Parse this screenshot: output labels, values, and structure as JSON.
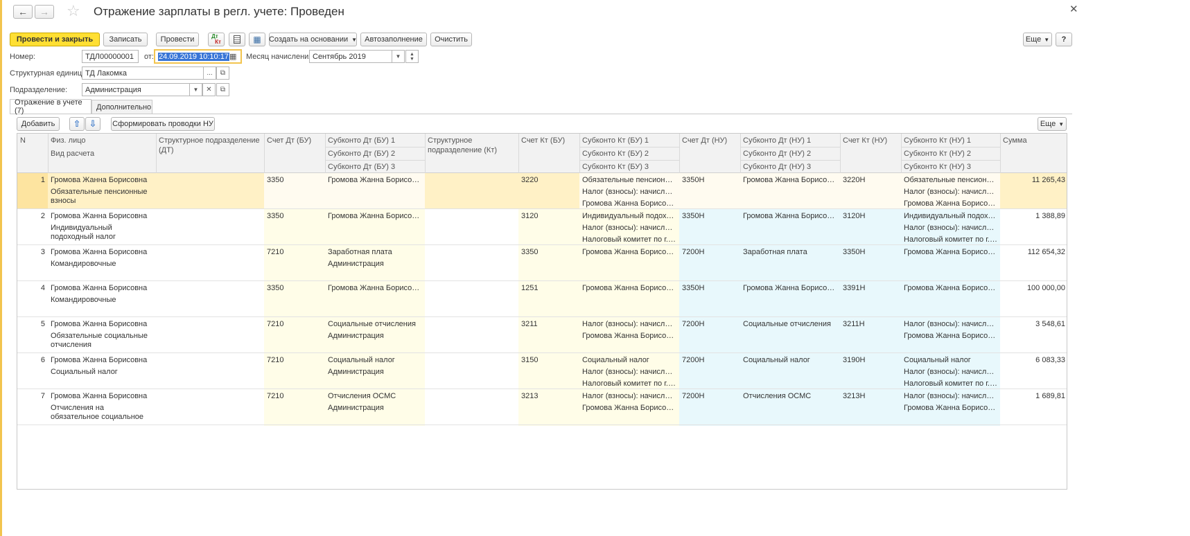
{
  "window": {
    "title": "Отражение зарплаты в регл. учете: Проведен"
  },
  "toolbar": {
    "post_close": "Провести и закрыть",
    "save": "Записать",
    "post": "Провести",
    "dtkt_icon_top": "Дт",
    "dtkt_icon_bottom": "Кт",
    "create_based": "Создать на основании",
    "autofill": "Автозаполнение",
    "clear": "Очистить",
    "more": "Еще",
    "help": "?"
  },
  "form": {
    "number_label": "Номер:",
    "number_value": "ТДЛ00000001",
    "from_label": "от:",
    "date_value": "24.09.2019 10:10:17",
    "month_label": "Месяц начисления:",
    "month_value": "Сентябрь 2019",
    "unit_label": "Структурная единица:",
    "unit_value": "ТД Лакомка",
    "dept_label": "Подразделение:",
    "dept_value": "Администрация"
  },
  "tabs": [
    {
      "label": "Отражение в учете (7)"
    },
    {
      "label": "Дополнительно"
    }
  ],
  "table_toolbar": {
    "add": "Добавить",
    "generate": "Сформировать проводки НУ",
    "more": "Еще"
  },
  "columns": {
    "n": "N",
    "person": "Физ. лицо",
    "calc_type": "Вид расчета",
    "dept_dt": "Структурное подразделение (ДТ)",
    "acc_dt_bu": "Счет Дт (БУ)",
    "sub_dt_bu_1": "Субконто Дт  (БУ) 1",
    "sub_dt_bu_2": "Субконто Дт  (БУ) 2",
    "sub_dt_bu_3": "Субконто Дт  (БУ) 3",
    "dept_kt": "Структурное подразделение (Кт)",
    "acc_kt_bu": "Счет Кт  (БУ)",
    "sub_kt_bu_1": "Субконто Кт  (БУ) 1",
    "sub_kt_bu_2": "Субконто Кт  (БУ) 2",
    "sub_kt_bu_3": "Субконто Кт  (БУ) 3",
    "acc_dt_nu": "Счет Дт (НУ)",
    "sub_dt_nu_1": "Субконто Дт (НУ) 1",
    "sub_dt_nu_2": "Субконто Дт (НУ) 2",
    "sub_dt_nu_3": "Субконто Дт (НУ) 3",
    "acc_kt_nu": "Счет Кт (НУ)",
    "sub_kt_nu_1": "Субконто Кт (НУ) 1",
    "sub_kt_nu_2": "Субконто Кт (НУ) 2",
    "sub_kt_nu_3": "Субконто Кт (НУ) 3",
    "sum": "Сумма"
  },
  "rows": [
    {
      "n": "1",
      "person": "Громова Жанна Борисовна",
      "calc": "Обязательные пенсионные взносы",
      "acc_dt_bu": "3350",
      "sub_dt_bu": [
        "Громова Жанна Борисовна",
        "",
        ""
      ],
      "acc_kt_bu": "3220",
      "sub_kt_bu": [
        "Обязательные пенсионны...",
        "Налог (взносы): начислено...",
        "Громова Жанна Борисовна"
      ],
      "acc_dt_nu": "3350Н",
      "sub_dt_nu": [
        "Громова Жанна Борисовна",
        "",
        ""
      ],
      "acc_kt_nu": "3220Н",
      "sub_kt_nu": [
        "Обязательные пенсионны...",
        "Налог (взносы): начислено...",
        "Громова Жанна Борисовна"
      ],
      "sum": "11 265,43"
    },
    {
      "n": "2",
      "person": "Громова Жанна Борисовна",
      "calc": "Индивидуальный подоходный налог",
      "acc_dt_bu": "3350",
      "sub_dt_bu": [
        "Громова Жанна Борисовна",
        "",
        ""
      ],
      "acc_kt_bu": "3120",
      "sub_kt_bu": [
        "Индивидуальный подоходн...",
        "Налог (взносы): начислено...",
        "Налоговый комитет по г.А..."
      ],
      "acc_dt_nu": "3350Н",
      "sub_dt_nu": [
        "Громова Жанна Борисовна",
        "",
        ""
      ],
      "acc_kt_nu": "3120Н",
      "sub_kt_nu": [
        "Индивидуальный подоходн...",
        "Налог (взносы): начислено...",
        "Налоговый комитет по г.А..."
      ],
      "sum": "1 388,89"
    },
    {
      "n": "3",
      "person": "Громова Жанна Борисовна",
      "calc": "Командировочные",
      "acc_dt_bu": "7210",
      "sub_dt_bu": [
        "Заработная плата",
        "Администрация",
        ""
      ],
      "acc_kt_bu": "3350",
      "sub_kt_bu": [
        "Громова Жанна Борисовна",
        "",
        ""
      ],
      "acc_dt_nu": "7200Н",
      "sub_dt_nu": [
        "Заработная плата",
        "",
        ""
      ],
      "acc_kt_nu": "3350Н",
      "sub_kt_nu": [
        "Громова Жанна Борисовна",
        "",
        ""
      ],
      "sum": "112 654,32"
    },
    {
      "n": "4",
      "person": "Громова Жанна Борисовна",
      "calc": "Командировочные",
      "acc_dt_bu": "3350",
      "sub_dt_bu": [
        "Громова Жанна Борисовна",
        "",
        ""
      ],
      "acc_kt_bu": "1251",
      "sub_kt_bu": [
        "Громова Жанна Борисовна",
        "",
        ""
      ],
      "acc_dt_nu": "3350Н",
      "sub_dt_nu": [
        "Громова Жанна Борисовна",
        "",
        ""
      ],
      "acc_kt_nu": "3391Н",
      "sub_kt_nu": [
        "Громова Жанна Борисовна",
        "",
        ""
      ],
      "sum": "100 000,00"
    },
    {
      "n": "5",
      "person": "Громова Жанна Борисовна",
      "calc": "Обязательные социальные отчисления",
      "acc_dt_bu": "7210",
      "sub_dt_bu": [
        "Социальные отчисления",
        "Администрация",
        ""
      ],
      "acc_kt_bu": "3211",
      "sub_kt_bu": [
        "Налог (взносы): начислено...",
        "Громова Жанна Борисовна",
        ""
      ],
      "acc_dt_nu": "7200Н",
      "sub_dt_nu": [
        "Социальные отчисления",
        "",
        ""
      ],
      "acc_kt_nu": "3211Н",
      "sub_kt_nu": [
        "Налог (взносы): начислено...",
        "Громова Жанна Борисовна",
        ""
      ],
      "sum": "3 548,61"
    },
    {
      "n": "6",
      "person": "Громова Жанна Борисовна",
      "calc": "Социальный налог",
      "acc_dt_bu": "7210",
      "sub_dt_bu": [
        "Социальный налог",
        "Администрация",
        ""
      ],
      "acc_kt_bu": "3150",
      "sub_kt_bu": [
        "Социальный налог",
        "Налог (взносы): начислено...",
        "Налоговый комитет по г.А..."
      ],
      "acc_dt_nu": "7200Н",
      "sub_dt_nu": [
        "Социальный налог",
        "",
        ""
      ],
      "acc_kt_nu": "3190Н",
      "sub_kt_nu": [
        "Социальный налог",
        "Налог (взносы): начислено...",
        "Налоговый комитет по г.А..."
      ],
      "sum": "6 083,33"
    },
    {
      "n": "7",
      "person": "Громова Жанна Борисовна",
      "calc": "Отчисления на обязательное социальное медицинское ...",
      "acc_dt_bu": "7210",
      "sub_dt_bu": [
        "Отчисления ОСМС",
        "Администрация",
        ""
      ],
      "acc_kt_bu": "3213",
      "sub_kt_bu": [
        "Налог (взносы): начислено...",
        "Громова Жанна Борисовна",
        ""
      ],
      "acc_dt_nu": "7200Н",
      "sub_dt_nu": [
        "Отчисления ОСМС",
        "",
        ""
      ],
      "acc_kt_nu": "3213Н",
      "sub_kt_nu": [
        "Налог (взносы): начислено...",
        "Громова Жанна Борисовна",
        ""
      ],
      "sum": "1 689,81"
    }
  ],
  "colors": {
    "accent_yellow": "#ffdf33",
    "bu_column_bg": "#fffde8",
    "nu_column_bg": "#e8f8fc",
    "selected_row_bg": "#fff1c6",
    "focus_border": "#f2c44e"
  }
}
